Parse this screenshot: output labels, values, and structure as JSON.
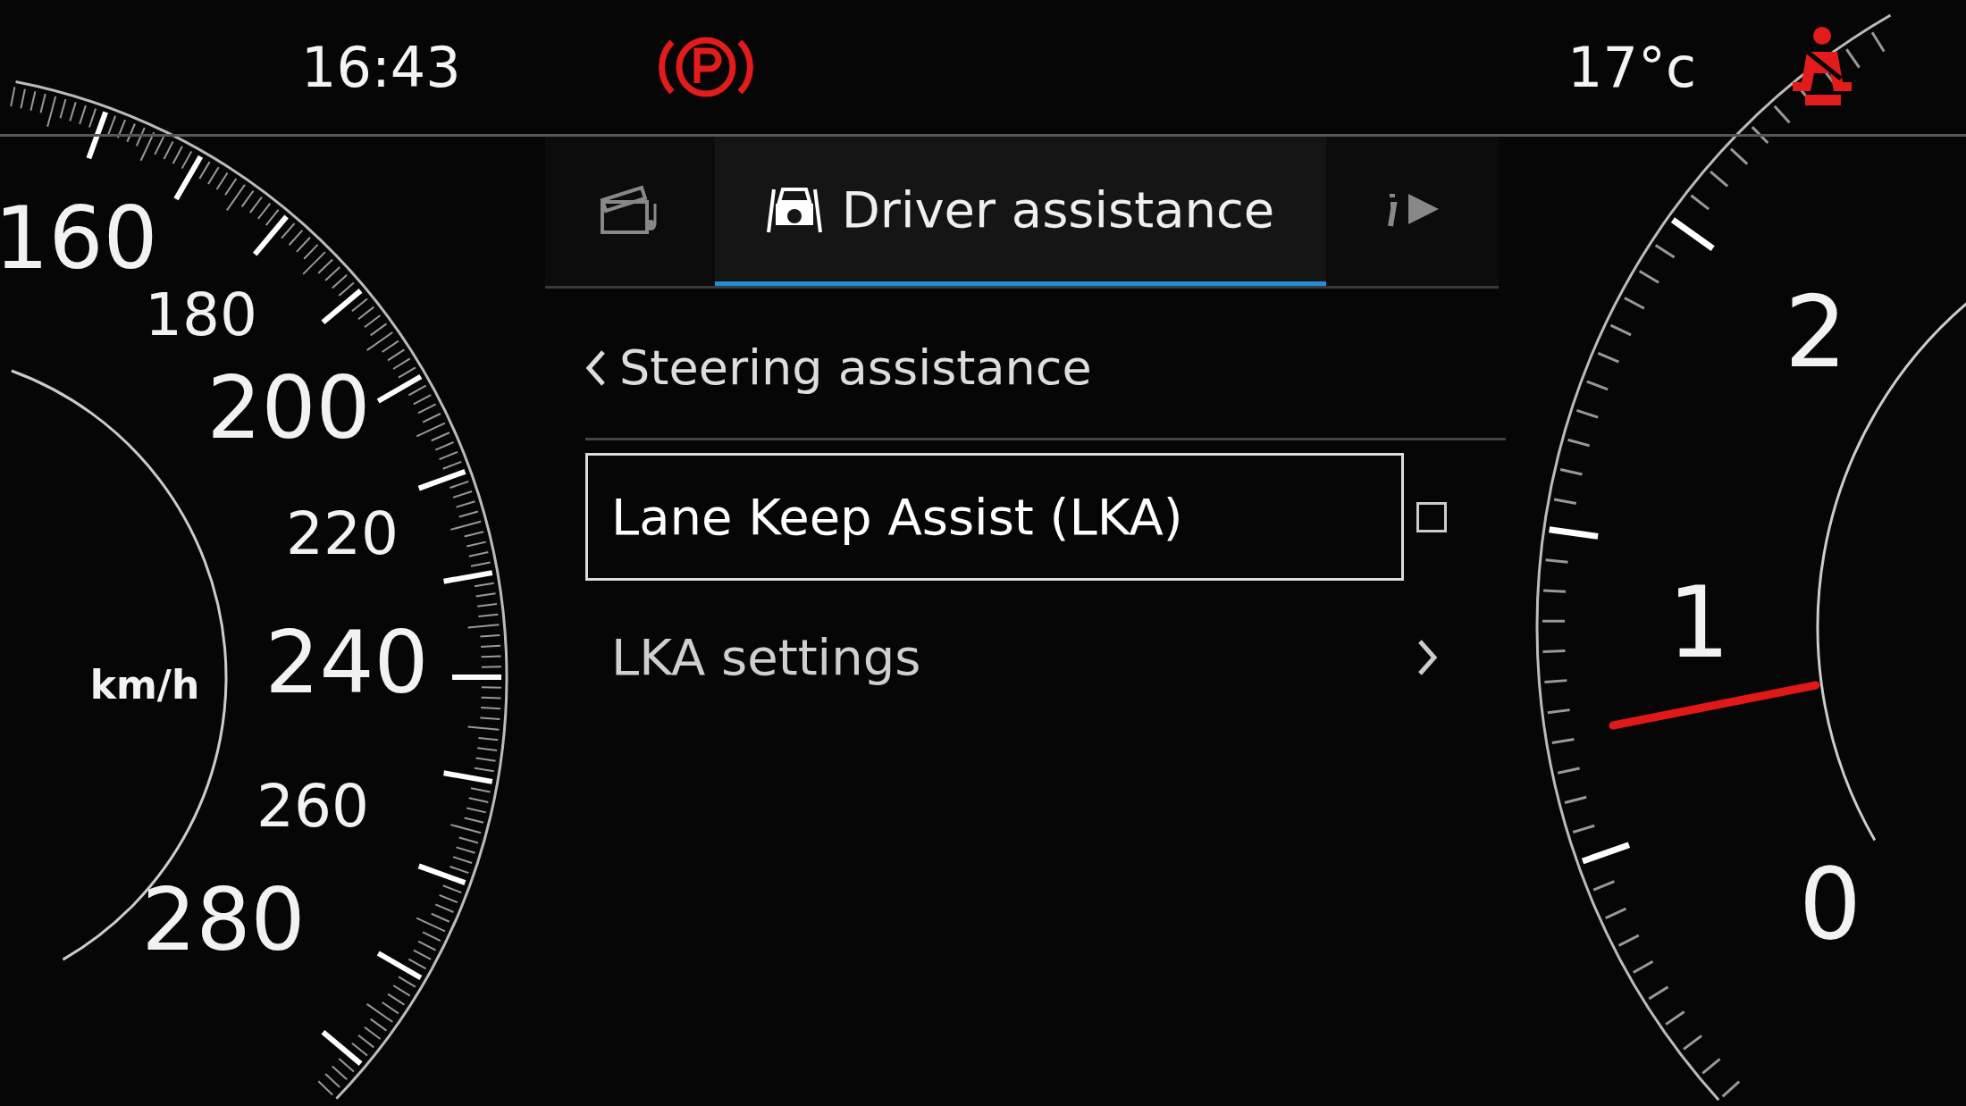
{
  "status_bar": {
    "time": "16:43",
    "temperature": "17°c"
  },
  "tabs": [
    {
      "kind": "media",
      "selected": false
    },
    {
      "kind": "driver",
      "label": "Driver assistance",
      "selected": true
    },
    {
      "kind": "info",
      "selected": false
    }
  ],
  "menu": {
    "back_label": "Steering assistance",
    "items": [
      {
        "kind": "checkbox",
        "label": "Lane Keep Assist (LKA)",
        "selected": true,
        "checked": false
      },
      {
        "kind": "submenu",
        "label": "LKA settings",
        "selected": false
      }
    ]
  },
  "speedometer": {
    "labels": [
      "160",
      "180",
      "200",
      "220",
      "240",
      "260",
      "280"
    ],
    "unit": "km/h"
  },
  "tachometer": {
    "labels": [
      "2",
      "1",
      "0"
    ]
  }
}
